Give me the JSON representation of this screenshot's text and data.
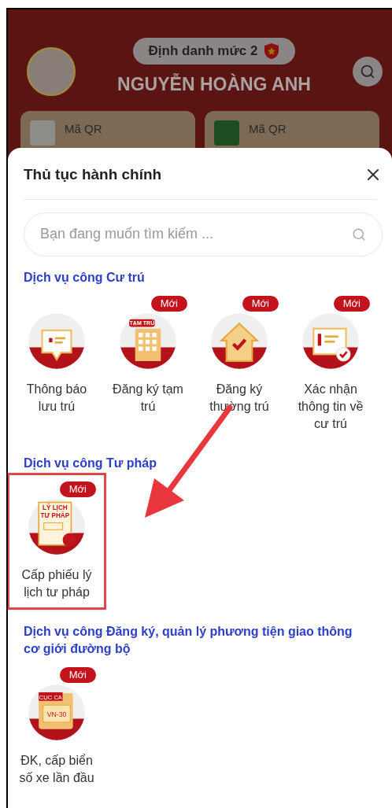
{
  "header": {
    "badge": "Định danh mức 2",
    "name": "NGUYỄN HOÀNG ANH",
    "cards": [
      {
        "kind": "id",
        "title": "Mã QR"
      },
      {
        "kind": "police",
        "title": "Mã QR"
      }
    ]
  },
  "sheet": {
    "title": "Thủ tục hành chính",
    "search": {
      "placeholder": "Bạn đang muốn tìm kiếm ..."
    },
    "sections": [
      {
        "title": "Dịch vụ công Cư trú",
        "items": [
          {
            "kind": "chat",
            "label": "Thông báo lưu trú",
            "highlighted": false
          },
          {
            "kind": "building",
            "icon_text": [
              "TẠM TRÚ"
            ],
            "badge": "Mới",
            "label": "Đăng ký tạm trú",
            "highlighted": false
          },
          {
            "kind": "house",
            "badge": "Mới",
            "label": "Đăng ký thường trú",
            "highlighted": false
          },
          {
            "kind": "info",
            "badge": "Mới",
            "label": "Xác nhận thông tin về cư trú",
            "highlighted": false
          }
        ]
      },
      {
        "title": "Dịch vụ công Tư pháp",
        "items": [
          {
            "kind": "document",
            "icon_text": [
              "LÝ LỊCH",
              "TƯ PHÁP"
            ],
            "badge": "Mới",
            "label": "Cấp phiếu lý lịch tư pháp",
            "highlighted": true
          }
        ]
      },
      {
        "title": "Dịch vụ công Đăng ký, quản lý phương tiện giao thông cơ giới đường bộ",
        "items": [
          {
            "kind": "plate",
            "icon_text": [
              "CỤC CA",
              "VN-30"
            ],
            "badge": "Mới",
            "label": "ĐK, cấp biển số xe lần đầu",
            "highlighted": false
          }
        ]
      }
    ]
  }
}
